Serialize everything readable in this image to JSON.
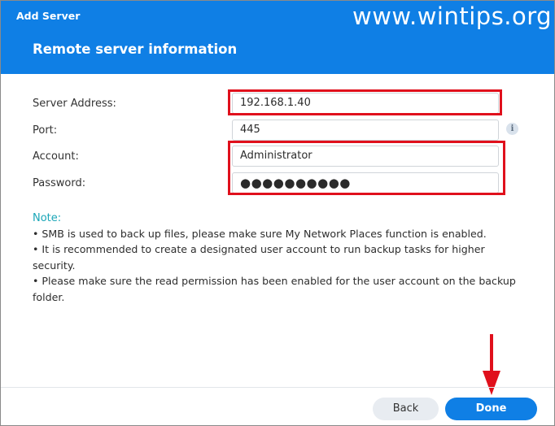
{
  "window": {
    "app_title": "Add Server",
    "section_title": "Remote server information",
    "watermark": "www.wintips.org"
  },
  "form": {
    "server_address": {
      "label": "Server Address:",
      "value": "192.168.1.40"
    },
    "port": {
      "label": "Port:",
      "value": "445"
    },
    "account": {
      "label": "Account:",
      "value": "Administrator"
    },
    "password": {
      "label": "Password:",
      "value": "●●●●●●●●●●"
    }
  },
  "icons": {
    "info": "info-icon",
    "arrow": "down-arrow-icon"
  },
  "note": {
    "title": "Note:",
    "lines": [
      "• SMB is used to back up files, please make sure My Network Places function is enabled.",
      "• It is recommended to create a designated user account to run backup tasks for higher",
      "security.",
      "• Please make sure the read permission has been enabled for the user account on the backup",
      "folder."
    ]
  },
  "footer": {
    "back_label": "Back",
    "done_label": "Done"
  },
  "colors": {
    "header": "#0f7fe5",
    "highlight": "#e0101c",
    "note_title": "#1aa6b7",
    "primary_button": "#0f7fe5"
  }
}
